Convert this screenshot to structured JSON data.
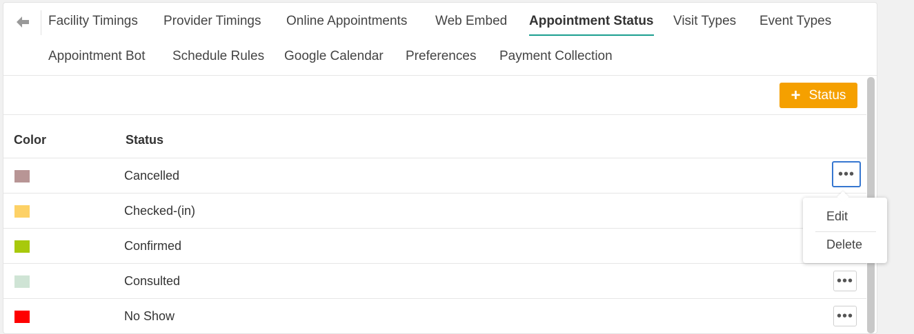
{
  "nav": {
    "tabs": [
      {
        "label": "Facility Timings"
      },
      {
        "label": "Provider Timings"
      },
      {
        "label": "Online Appointments"
      },
      {
        "label": "Web Embed"
      },
      {
        "label": "Appointment Status"
      },
      {
        "label": "Visit Types"
      },
      {
        "label": "Event Types"
      },
      {
        "label": "Appointment Bot"
      },
      {
        "label": "Schedule Rules"
      },
      {
        "label": "Google Calendar"
      },
      {
        "label": "Preferences"
      },
      {
        "label": "Payment Collection"
      }
    ],
    "active_tab": "Appointment Status",
    "back_icon": "arrow-left-icon"
  },
  "toolbar": {
    "add_label": "Status",
    "add_color": "#f5a000"
  },
  "table": {
    "headers": {
      "color": "Color",
      "status": "Status"
    },
    "rows": [
      {
        "status": "Cancelled",
        "color": "#b89595"
      },
      {
        "status": "Checked-(in)",
        "color": "#fdd166"
      },
      {
        "status": "Confirmed",
        "color": "#a8c90c"
      },
      {
        "status": "Consulted",
        "color": "#cfe4d5"
      },
      {
        "status": "No Show",
        "color": "#fe0000"
      }
    ],
    "actions_icon": "more-horizontal-icon"
  },
  "context_menu": {
    "items": [
      {
        "label": "Edit"
      },
      {
        "label": "Delete"
      }
    ]
  },
  "colors": {
    "active_tab_underline": "#1a9e8f",
    "focus_ring": "#3576d0"
  }
}
